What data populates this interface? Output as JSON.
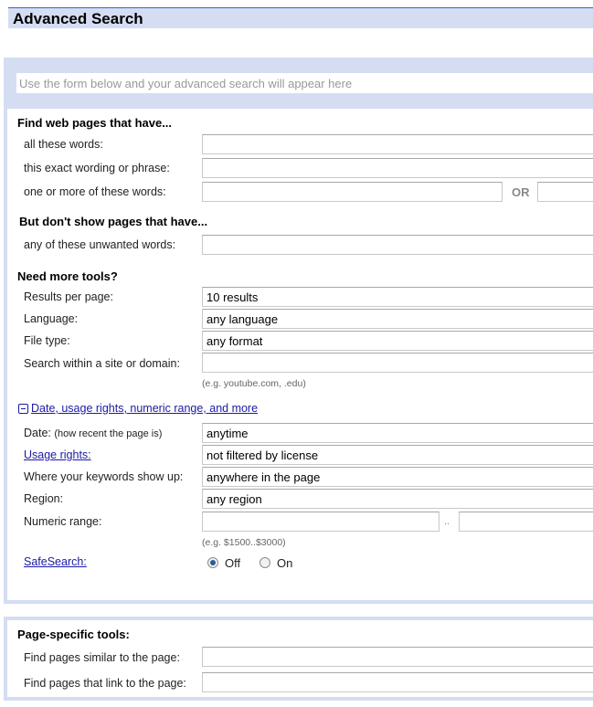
{
  "header": {
    "title": "Advanced Search"
  },
  "query_bar": {
    "placeholder": "Use the form below and your advanced search will appear here"
  },
  "find_section": {
    "title": "Find web pages that have...",
    "all_words_label": "all these words:",
    "exact_phrase_label": "this exact wording or phrase:",
    "any_words_label": "one or more of these words:",
    "or_label": "OR",
    "all_words_value": "",
    "exact_phrase_value": "",
    "any_words_value_1": "",
    "any_words_value_2": ""
  },
  "exclude_section": {
    "title": "But don't show pages that have...",
    "unwanted_label": "any of these unwanted words:",
    "unwanted_value": ""
  },
  "tools_section": {
    "title": "Need more tools?",
    "results_label": "Results per page:",
    "results_value": "10 results",
    "language_label": "Language:",
    "language_value": "any language",
    "filetype_label": "File type:",
    "filetype_value": "any format",
    "site_label": "Search within a site or domain:",
    "site_value": "",
    "site_hint": "(e.g. youtube.com, .edu)"
  },
  "more_toggle": {
    "label": "Date, usage rights, numeric range, and more",
    "icon": "collapse-minus-icon"
  },
  "more_section": {
    "date_label": "Date:",
    "date_hint": "(how recent the page is)",
    "date_value": "anytime",
    "usage_label": "Usage rights:",
    "usage_value": "not filtered by license",
    "where_label": "Where your keywords show up:",
    "where_value": "anywhere in the page",
    "region_label": "Region:",
    "region_value": "any region",
    "numeric_label": "Numeric range:",
    "numeric_from": "",
    "numeric_to": "",
    "numeric_sep": "..",
    "numeric_hint": "(e.g. $1500..$3000)",
    "safesearch_label": "SafeSearch:",
    "safesearch_options": [
      {
        "label": "Off",
        "selected": true
      },
      {
        "label": "On",
        "selected": false
      }
    ]
  },
  "page_tools": {
    "title": "Page-specific tools:",
    "similar_label": "Find pages similar to the page:",
    "similar_value": "",
    "link_label": "Find pages that link to the page:",
    "link_value": ""
  }
}
